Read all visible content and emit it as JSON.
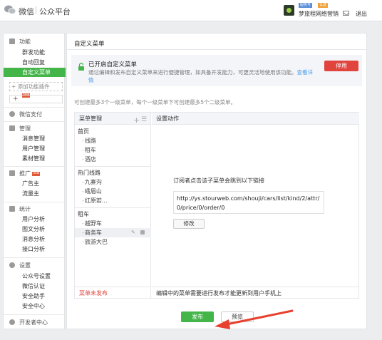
{
  "topbar": {
    "brand": "微信",
    "brand2": "公众平台",
    "account_badge_left": "服务号",
    "account_badge_right": "认证",
    "account_name": "梦旅程网络营销",
    "logout": "退出"
  },
  "sidebar": {
    "sections": [
      {
        "head": "功能",
        "icon": "grid-icon",
        "items": [
          "群发功能",
          "自动回复",
          "自定义菜单"
        ]
      },
      {
        "add_plugin": "添加功能插件",
        "plus": "+"
      },
      {
        "head": "微信支付",
        "icon": "wechat-pay-icon"
      },
      {
        "head": "管理",
        "icon": "folder-icon",
        "items": [
          "消息管理",
          "用户管理",
          "素材管理"
        ]
      },
      {
        "head": "推广",
        "icon": "promote-icon",
        "items": [
          "广告主",
          "流量主"
        ]
      },
      {
        "head": "统计",
        "icon": "chart-icon",
        "items": [
          "用户分析",
          "图文分析",
          "消息分析",
          "接口分析"
        ]
      },
      {
        "head": "设置",
        "icon": "gear-icon",
        "items": [
          "公众号设置",
          "微信认证",
          "安全助手",
          "安全中心"
        ]
      },
      {
        "head": "开发者中心",
        "icon": "developer-icon"
      }
    ],
    "active_item": "自定义菜单"
  },
  "main": {
    "title": "自定义菜单",
    "notice_title": "已开启自定义菜单",
    "notice_desc": "通过编辑和发布自定义菜单来进行便捷管理，如具备开发能力，可更灵活地使用该功能。",
    "notice_link": "查看详情",
    "disable_button": "停用",
    "hint": "可创建最多3个一级菜单，每个一级菜单下可创建最多5个二级菜单。",
    "menu_header": "菜单管理",
    "action_header": "设置动作",
    "menus": [
      {
        "name": "首页",
        "children": [
          "线路",
          "租车",
          "酒店"
        ]
      },
      {
        "name": "热门线路",
        "children": [
          "九寨沟",
          "峨眉山",
          "红原若..."
        ]
      },
      {
        "name": "租车",
        "children": [
          "越野车",
          "商务车",
          "旅游大巴"
        ]
      }
    ],
    "selected_child": "商务车",
    "action_text": "订阅者点击该子菜单会跳到以下链接",
    "url": "http://ys.stourweb.com/shouji/cars/list/kind/2/attr/0/price/0/order/0",
    "modify_button": "修改",
    "footer_status": "菜单未发布",
    "footer_note": "编辑中的菜单需要进行发布才能更新到用户手机上",
    "publish_button": "发布",
    "preview_button": "预览"
  },
  "colors": {
    "green": "#44b549",
    "red": "#e0443c",
    "link": "#459ae9",
    "arrow": "#e8402f"
  }
}
